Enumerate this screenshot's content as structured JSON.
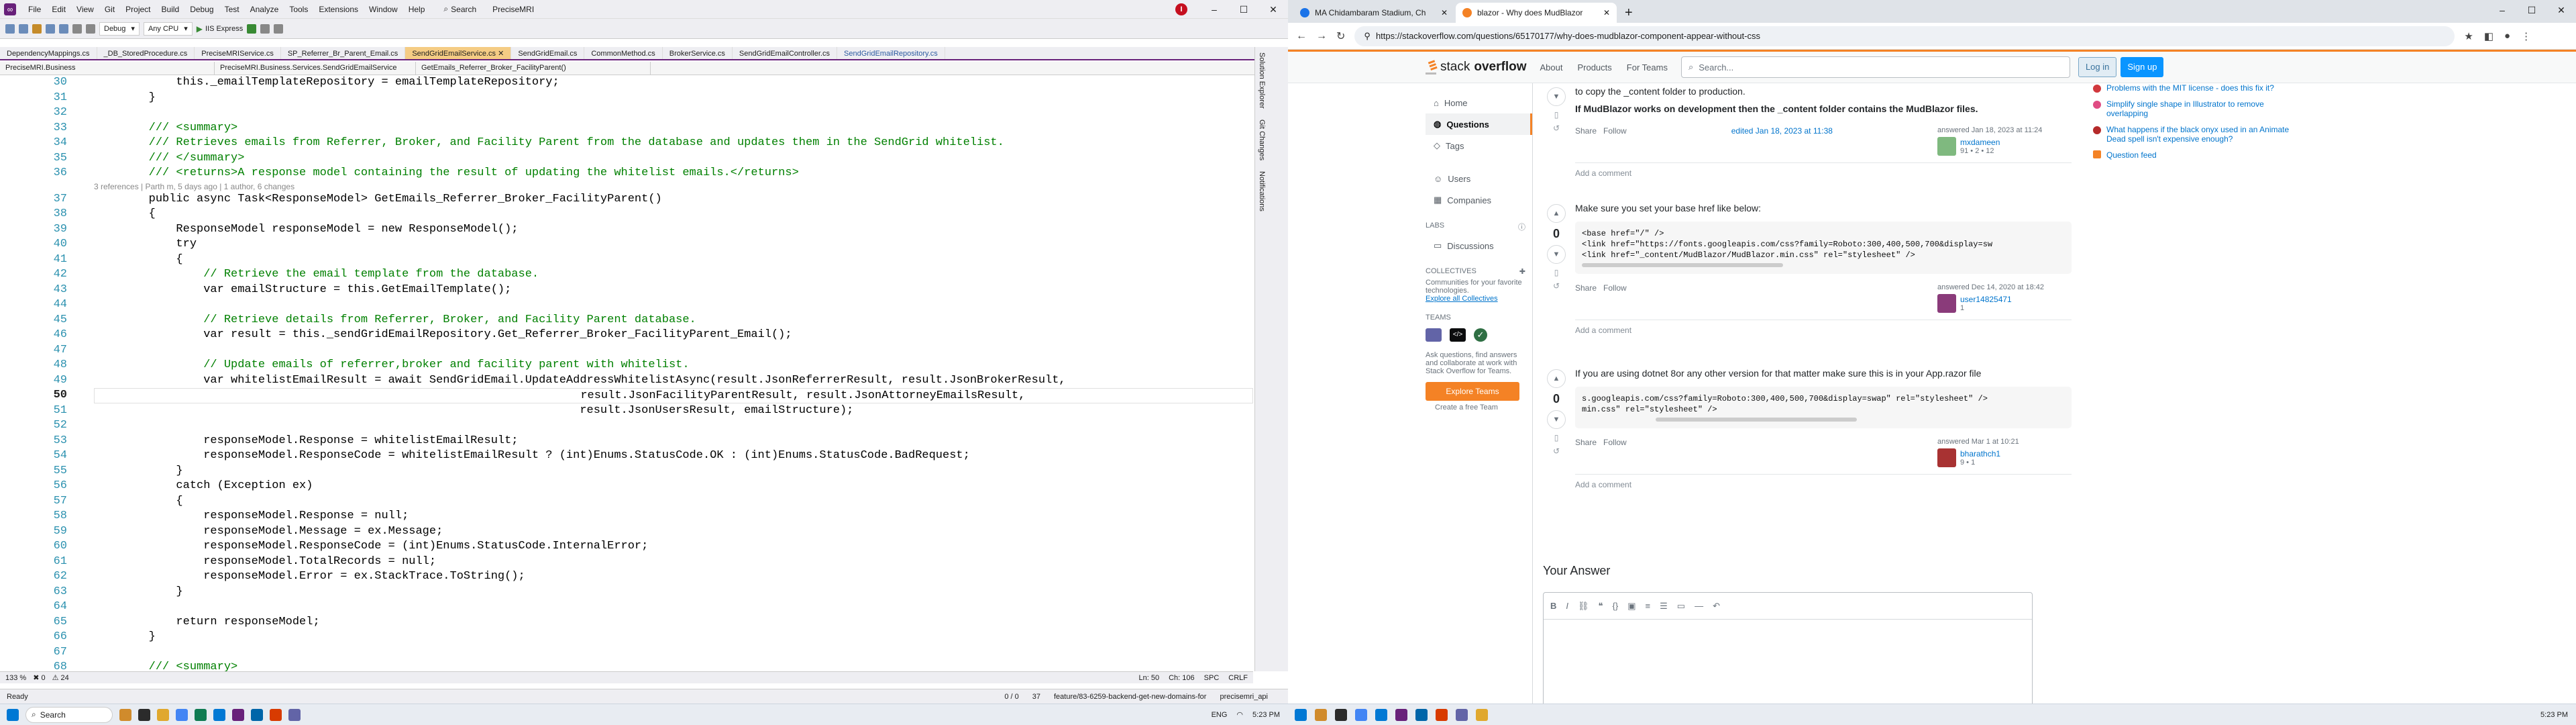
{
  "vs": {
    "menu": [
      "File",
      "Edit",
      "View",
      "Git",
      "Project",
      "Build",
      "Debug",
      "Test",
      "Analyze",
      "Tools",
      "Extensions",
      "Window",
      "Help"
    ],
    "search_label": "Search",
    "solution": "PreciseMRI",
    "user_initial": "I",
    "win_min": "–",
    "win_max": "☐",
    "win_close": "✕",
    "config": "Debug",
    "platform": "Any CPU",
    "run_label": "IIS Express",
    "tabs": [
      {
        "label": "DependencyMappings.cs",
        "state": "normal"
      },
      {
        "label": "_DB_StoredProcedure.cs",
        "state": "normal"
      },
      {
        "label": "PreciseMRIService.cs",
        "state": "normal"
      },
      {
        "label": "SP_Referrer_Br_Parent_Email.cs",
        "state": "normal"
      },
      {
        "label": "SendGridEmailService.cs",
        "state": "active"
      },
      {
        "label": "SendGridEmail.cs",
        "state": "normal"
      },
      {
        "label": "CommonMethod.cs",
        "state": "normal"
      },
      {
        "label": "BrokerService.cs",
        "state": "normal"
      },
      {
        "label": "SendGridEmailController.cs",
        "state": "normal"
      },
      {
        "label": "SendGridEmailRepository.cs",
        "state": "pinned"
      }
    ],
    "nav": {
      "project": "PreciseMRI.Business",
      "class": "PreciseMRI.Business.Services.SendGridEmailService",
      "member": "GetEmails_Referrer_Broker_FacilityParent()"
    },
    "codelens": "3 references | Parth m, 5 days ago | 1 author, 6 changes",
    "lines": [
      {
        "n": "30",
        "t": "            this._emailTemplateRepository = emailTemplateRepository;"
      },
      {
        "n": "31",
        "t": "        }"
      },
      {
        "n": "32",
        "t": ""
      },
      {
        "n": "33",
        "t": "        /// <summary>"
      },
      {
        "n": "34",
        "t": "        /// Retrieves emails from Referrer, Broker, and Facility Parent from the database and updates them in the SendGrid whitelist."
      },
      {
        "n": "35",
        "t": "        /// </summary>"
      },
      {
        "n": "36",
        "t": "        /// <returns>A response model containing the result of updating the whitelist emails.</returns>"
      },
      {
        "n": "37",
        "t": "        public async Task<ResponseModel> GetEmails_Referrer_Broker_FacilityParent()"
      },
      {
        "n": "38",
        "t": "        {"
      },
      {
        "n": "39",
        "t": "            ResponseModel responseModel = new ResponseModel();"
      },
      {
        "n": "40",
        "t": "            try"
      },
      {
        "n": "41",
        "t": "            {"
      },
      {
        "n": "42",
        "t": "                // Retrieve the email template from the database."
      },
      {
        "n": "43",
        "t": "                var emailStructure = this.GetEmailTemplate();"
      },
      {
        "n": "44",
        "t": ""
      },
      {
        "n": "45",
        "t": "                // Retrieve details from Referrer, Broker, and Facility Parent database."
      },
      {
        "n": "46",
        "t": "                var result = this._sendGridEmailRepository.Get_Referrer_Broker_FacilityParent_Email();"
      },
      {
        "n": "47",
        "t": ""
      },
      {
        "n": "48",
        "t": "                // Update emails of referrer,broker and facility parent with whitelist."
      },
      {
        "n": "49",
        "t": "                var whitelistEmailResult = await SendGridEmail.UpdateAddressWhitelistAsync(result.JsonReferrerResult, result.JsonBrokerResult,"
      },
      {
        "n": "50",
        "t": "                                                                       result.JsonFacilityParentResult, result.JsonAttorneyEmailsResult,"
      },
      {
        "n": "51",
        "t": "                                                                       result.JsonUsersResult, emailStructure);"
      },
      {
        "n": "52",
        "t": ""
      },
      {
        "n": "53",
        "t": "                responseModel.Response = whitelistEmailResult;"
      },
      {
        "n": "54",
        "t": "                responseModel.ResponseCode = whitelistEmailResult ? (int)Enums.StatusCode.OK : (int)Enums.StatusCode.BadRequest;"
      },
      {
        "n": "55",
        "t": "            }"
      },
      {
        "n": "56",
        "t": "            catch (Exception ex)"
      },
      {
        "n": "57",
        "t": "            {"
      },
      {
        "n": "58",
        "t": "                responseModel.Response = null;"
      },
      {
        "n": "59",
        "t": "                responseModel.Message = ex.Message;"
      },
      {
        "n": "60",
        "t": "                responseModel.ResponseCode = (int)Enums.StatusCode.InternalError;"
      },
      {
        "n": "61",
        "t": "                responseModel.TotalRecords = null;"
      },
      {
        "n": "62",
        "t": "                responseModel.Error = ex.StackTrace.ToString();"
      },
      {
        "n": "63",
        "t": "            }"
      },
      {
        "n": "64",
        "t": ""
      },
      {
        "n": "65",
        "t": "            return responseModel;"
      },
      {
        "n": "66",
        "t": "        }"
      },
      {
        "n": "67",
        "t": ""
      },
      {
        "n": "68",
        "t": "        /// <summary>"
      }
    ],
    "side_tabs": [
      "Solution Explorer",
      "Git Changes",
      "Notifications"
    ],
    "bottom": {
      "zoom": "133 %",
      "errors": "0",
      "warnings": "24",
      "ln": "Ln: 50",
      "ch": "Ch: 106",
      "spc": "SPC",
      "crlf": "CRLF"
    },
    "status": {
      "ready": "Ready",
      "changes": "0 / 0",
      "pending": "37",
      "branch": "feature/83-6259-backend-get-new-domains-for",
      "repo": "precisemri_api"
    }
  },
  "taskbar_left": {
    "search": "Search",
    "lang": "ENG",
    "time": "5:23 PM"
  },
  "browser": {
    "tabs": [
      {
        "label": "MA Chidambaram Stadium, Ch",
        "active": false
      },
      {
        "label": "blazor - Why does MudBlazor",
        "active": true
      }
    ],
    "new_tab": "+",
    "url": "https://stackoverflow.com/questions/65170177/why-does-mudblazor-component-appear-without-css"
  },
  "so": {
    "brand_light": "stack",
    "brand_bold": "overflow",
    "links": [
      "About",
      "Products",
      "For Teams"
    ],
    "search_placeholder": "Search...",
    "login": "Log in",
    "signup": "Sign up",
    "nav": {
      "home": "Home",
      "questions": "Questions",
      "tags": "Tags",
      "users": "Users",
      "companies": "Companies"
    },
    "labs_head": "LABS",
    "discussions": "Discussions",
    "collectives_head": "COLLECTIVES",
    "collectives_text": "Communities for your favorite technologies.",
    "collectives_link": "Explore all Collectives",
    "teams_head": "TEAMS",
    "teams_text": "Ask questions, find answers and collaborate at work with Stack Overflow for Teams.",
    "teams_button": "Explore Teams",
    "teams_free": "Create a free Team",
    "a1": {
      "line1": "to copy the _content folder to production.",
      "line2": "If MudBlazor works on development then the _content folder contains the MudBlazor files.",
      "share": "Share",
      "follow": "Follow",
      "edited": "edited Jan 18, 2023 at 11:38",
      "answered": "answered Jan 18, 2023 at 11:24",
      "user": "mxdameen",
      "rep": "91 • 2 • 12",
      "add_comment": "Add a comment"
    },
    "a2": {
      "votes": "0",
      "intro": "Make sure you set your base href like below:",
      "code1": "<base href=\"/\" />",
      "code2": "<link href=\"https://fonts.googleapis.com/css?family=Roboto:300,400,500,700&display=sw",
      "code3": "<link href=\"_content/MudBlazor/MudBlazor.min.css\" rel=\"stylesheet\" />",
      "share": "Share",
      "follow": "Follow",
      "answered": "answered Dec 14, 2020 at 18:42",
      "user": "user14825471",
      "rep": "1",
      "add_comment": "Add a comment"
    },
    "a3": {
      "votes": "0",
      "intro": "If you are using dotnet 8or any other version for that matter make sure this is in your App.razor file",
      "code1": "s.googleapis.com/css?family=Roboto:300,400,500,700&display=swap\" rel=\"stylesheet\" />",
      "code2": "min.css\" rel=\"stylesheet\" />",
      "share": "Share",
      "follow": "Follow",
      "answered": "answered Mar 1 at 10:21",
      "user": "bharathch1",
      "rep": "9 • 1",
      "add_comment": "Add a comment"
    },
    "your_answer": "Your Answer",
    "sidebar": [
      "Problems with the MIT license - does this fix it?",
      "Simplify single shape in Illustrator to remove overlapping",
      "What happens if the black onyx used in an Animate Dead spell isn't expensive enough?"
    ],
    "feed": "Question feed"
  },
  "taskbar_right": {
    "time": "5:23 PM"
  }
}
